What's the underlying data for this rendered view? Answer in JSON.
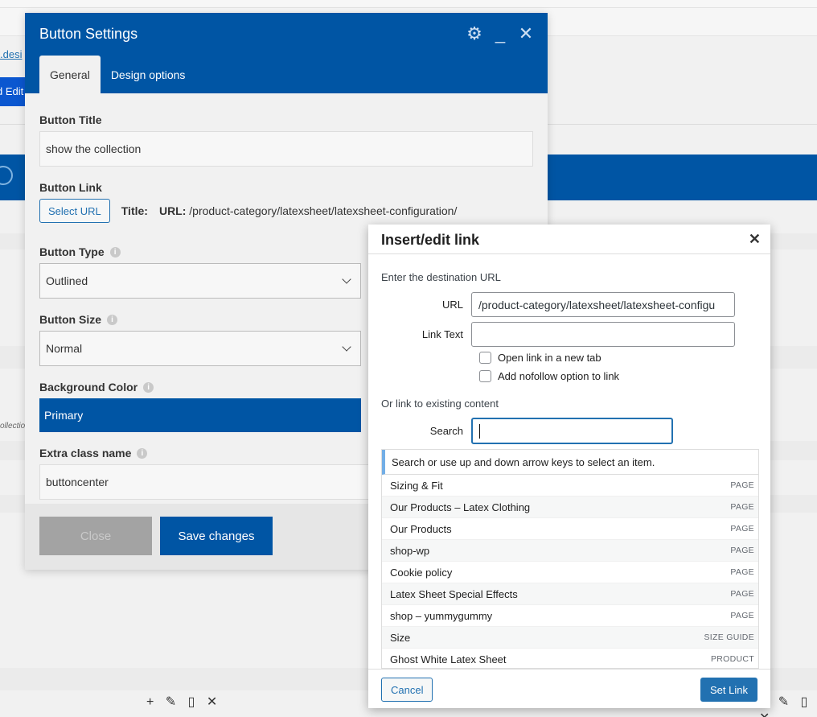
{
  "background": {
    "link_text": ".desi",
    "edit_text": "d Edit",
    "collection_text": "ollection",
    "toolbar_left": "+ ✎ ▯ ✕",
    "toolbar_right": "+ ✎ ▯ ✕"
  },
  "button_settings": {
    "title": "Button Settings",
    "tabs": [
      "General",
      "Design options"
    ],
    "fields": {
      "title_label": "Button Title",
      "title_value": "show the collection",
      "link_label": "Button Link",
      "select_url": "Select URL",
      "link_title_label": "Title:",
      "link_url_label": "URL:",
      "link_url_value": "/product-category/latexsheet/latexsheet-configuration/",
      "type_label": "Button Type",
      "type_value": "Outlined",
      "size_label": "Button Size",
      "size_value": "Normal",
      "bg_color_label": "Background Color",
      "bg_color_value": "Primary",
      "extra_class_label": "Extra class name",
      "extra_class_value": "buttoncenter"
    },
    "close_button": "Close",
    "save_button": "Save changes",
    "accent_color": "#0055a4"
  },
  "link_modal": {
    "title": "Insert/edit link",
    "dest_heading": "Enter the destination URL",
    "url_label": "URL",
    "url_value": "/product-category/latexsheet/latexsheet-configu",
    "link_text_label": "Link Text",
    "link_text_value": "",
    "open_new_tab": "Open link in a new tab",
    "nofollow": "Add nofollow option to link",
    "existing_heading": "Or link to existing content",
    "search_label": "Search",
    "search_value": "",
    "results_info": "Search or use up and down arrow keys to select an item.",
    "results": [
      {
        "title": "Sizing & Fit",
        "type": "PAGE"
      },
      {
        "title": "Our Products – Latex Clothing",
        "type": "PAGE"
      },
      {
        "title": "Our Products",
        "type": "PAGE"
      },
      {
        "title": "shop-wp",
        "type": "PAGE"
      },
      {
        "title": "Cookie policy",
        "type": "PAGE"
      },
      {
        "title": "Latex Sheet Special Effects",
        "type": "PAGE"
      },
      {
        "title": "shop – yummygummy",
        "type": "PAGE"
      },
      {
        "title": "Size",
        "type": "SIZE GUIDE"
      },
      {
        "title": "Ghost White Latex Sheet",
        "type": "PRODUCT"
      }
    ],
    "cancel": "Cancel",
    "set_link": "Set Link",
    "link_color": "#2271b1"
  }
}
